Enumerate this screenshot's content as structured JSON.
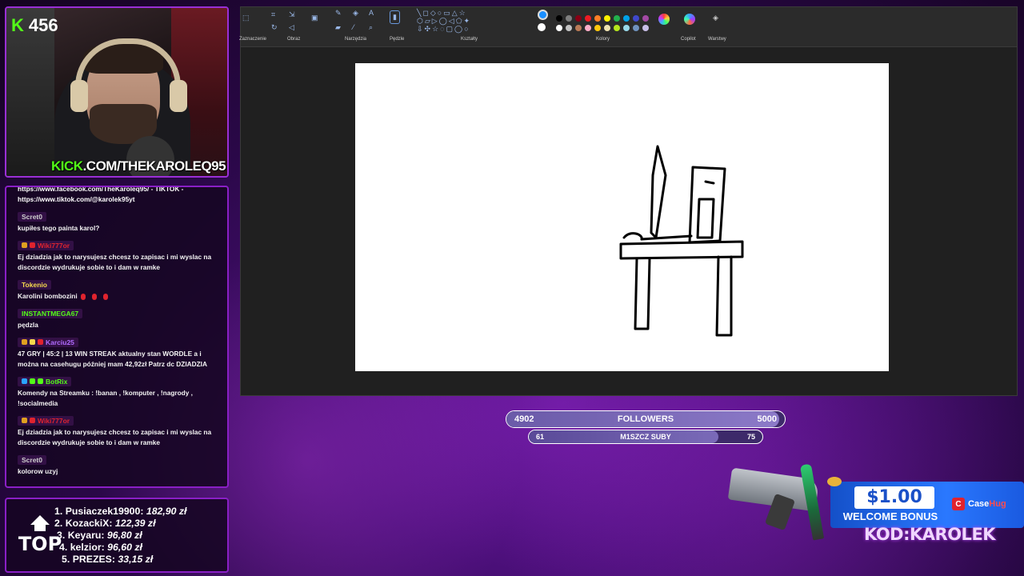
{
  "webcam": {
    "follower_count": "456",
    "kick_prefix": "KICK",
    "kick_url": ".COM/THEKAROLEQ95"
  },
  "chat": {
    "top_lines": [
      "https://www.facebook.com/TheKaroleq95/ - TIKTOK -",
      "https://www.tiktok.com/@karolek95yt"
    ],
    "messages": [
      {
        "user": "Scret0",
        "user_color": "#cfcfcf",
        "badges": [],
        "text": "kupiłes tego painta karol?"
      },
      {
        "user": "Wiki777or",
        "user_color": "#e0232e",
        "badges": [
          "#e0a020",
          "#e0232e"
        ],
        "text": "Ej dziadzia jak to narysujesz chcesz to zapisac i mi wyslac na discordzie wydrukuje sobie to i dam w ramke"
      },
      {
        "user": "Tokenio",
        "user_color": "#f7d94c",
        "badges": [],
        "text": "Karolini bombozini",
        "emotes": 3
      },
      {
        "user": "INSTANTMEGA67",
        "user_color": "#53fc18",
        "badges": [],
        "text": "pędzla"
      },
      {
        "user": "Karciu25",
        "user_color": "#b06cff",
        "badges": [
          "#e0a020",
          "#f7d94c",
          "#e0232e"
        ],
        "text": "47 GRY | 45:2 | 13 WIN STREAK aktualny stan WORDLE a i można na casehugu później mam 42,92zł Patrz dc DZIADZIA"
      },
      {
        "user": "BotRix",
        "user_color": "#53fc18",
        "badges": [
          "#2aa3ff",
          "#53fc18",
          "#53fc18"
        ],
        "text": "Komendy na Streamku : !banan , !komputer , !nagrody , !socialmedia"
      },
      {
        "user": "Wiki777or",
        "user_color": "#e0232e",
        "badges": [
          "#e0a020",
          "#e0232e"
        ],
        "text": "Ej dziadzia jak to narysujesz chcesz to zapisac i mi wyslac na discordzie wydrukuje sobie to i dam w ramke"
      },
      {
        "user": "Scret0",
        "user_color": "#cfcfcf",
        "badges": [],
        "text": "kolorow uzyj"
      }
    ]
  },
  "top_donors": {
    "label": "TOP",
    "entries": [
      {
        "rank": "1.",
        "name": "Pusiaczek19900:",
        "amount": "182,90 zł"
      },
      {
        "rank": "2.",
        "name": "KozackiX:",
        "amount": "122,39 zł"
      },
      {
        "rank": "3.",
        "name": "Keyaru:",
        "amount": "96,80 zł"
      },
      {
        "rank": "4.",
        "name": "kelzior:",
        "amount": "96,60 zł"
      },
      {
        "rank": "5.",
        "name": "PREZES:",
        "amount": "33,15 zł"
      }
    ]
  },
  "paint": {
    "ribbon_groups": [
      "Zaznaczenie",
      "Obraz",
      "Narzędzia",
      "Pędzle",
      "Kształty",
      "Kolory",
      "Copilot",
      "Warstwy"
    ],
    "palette": [
      "#000000",
      "#7f7f7f",
      "#880015",
      "#ed1c24",
      "#ff7f27",
      "#fff200",
      "#22b14c",
      "#00a2e8",
      "#3f48cc",
      "#a349a4",
      "#ffffff",
      "#c3c3c3",
      "#b97a57",
      "#ffaec9",
      "#ffc90e",
      "#efe4b0",
      "#b5e61d",
      "#99d9ea",
      "#7092be",
      "#c8bfe7"
    ],
    "primary_color": "#1a8fff",
    "secondary_color": "#ffffff"
  },
  "goals": {
    "followers": {
      "current": "4902",
      "label": "FOLLOWERS",
      "target": "5000",
      "progress": 0.98
    },
    "subs": {
      "current": "61",
      "label": "M1SZCZ SUBY",
      "target": "75",
      "progress": 0.81
    }
  },
  "ad": {
    "price": "$1.00",
    "welcome": "WELCOME BONUS",
    "brand_case": "Case",
    "brand_hug": "Hug",
    "promo_code": "KOD:KAROLEK"
  }
}
